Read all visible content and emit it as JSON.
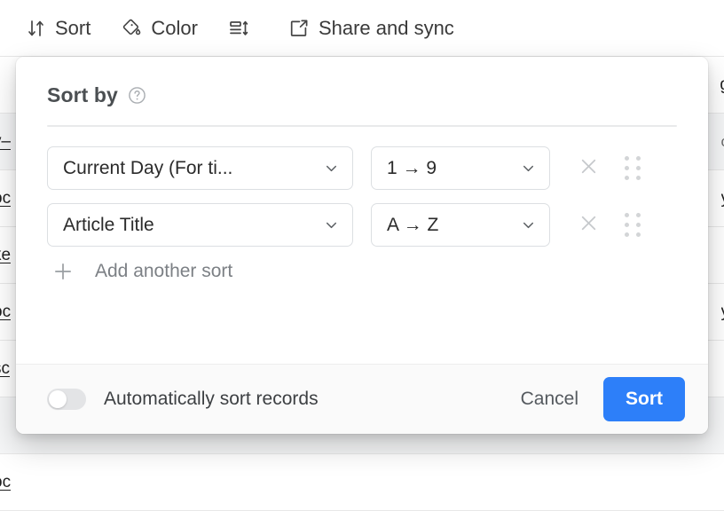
{
  "toolbar": {
    "items": [
      {
        "label": "Sort",
        "icon": "sort-arrows-icon"
      },
      {
        "label": "Color",
        "icon": "paint-bucket-icon"
      },
      {
        "label": "",
        "icon": "row-height-icon"
      },
      {
        "label": "Share and sync",
        "icon": "share-external-icon"
      }
    ]
  },
  "background_grid": {
    "rows": [
      {
        "left": "",
        "right": "g",
        "tint": false
      },
      {
        "left": "v–",
        "right": "o",
        "tint": true
      },
      {
        "left": "oc",
        "right": "y",
        "tint": false
      },
      {
        "left": "ke",
        "right": "",
        "tint": false
      },
      {
        "left": "oc",
        "right": "y",
        "tint": false
      },
      {
        "left": "sc",
        "right": "",
        "tint": false
      },
      {
        "left": "",
        "right": "",
        "tint": true
      },
      {
        "left": "oc",
        "right": "",
        "tint": false
      }
    ]
  },
  "dialog": {
    "title": "Sort by",
    "help_icon": "question-circle-icon",
    "sorts": [
      {
        "field": "Current Day (For ti...",
        "direction": "1 → 9",
        "remove_icon": "close-x-icon",
        "drag_icon": "drag-handle-icon"
      },
      {
        "field": "Article Title",
        "direction": "A → Z",
        "remove_icon": "close-x-icon",
        "drag_icon": "drag-handle-icon"
      }
    ],
    "add_sort": {
      "label": "Add another sort",
      "icon": "plus-icon"
    },
    "footer": {
      "auto_sort_label": "Automatically sort records",
      "auto_sort_enabled": false,
      "cancel_label": "Cancel",
      "confirm_label": "Sort"
    }
  },
  "colors": {
    "primary": "#2d7ff9",
    "dialog_bg": "#ffffff",
    "footer_bg": "#fafafa",
    "text": "#2b2b2b",
    "muted": "#7c8085",
    "border": "#dcdfe2"
  }
}
